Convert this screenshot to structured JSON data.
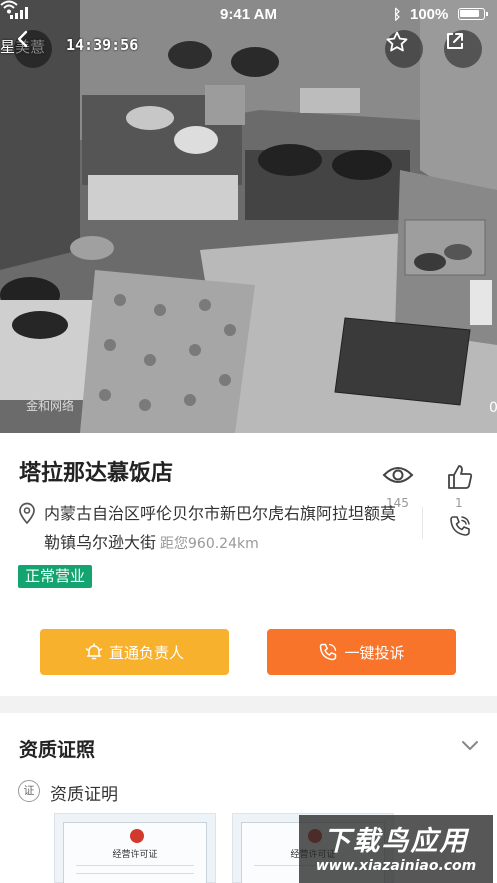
{
  "status_bar": {
    "time": "9:41 AM",
    "battery": "100%"
  },
  "camera": {
    "label": "星美薏",
    "timestamp": "14:39:56",
    "watermark": "金和网络",
    "edge_digit": "0"
  },
  "shop": {
    "name": "塔拉那达慕饭店",
    "address": "内蒙古自治区呼伦贝尔市新巴尔虎右旗阿拉坦额莫勒镇乌尔逊大街",
    "distance": "距您960.24km",
    "status": "正常营业",
    "views": "145",
    "likes": "1"
  },
  "actions": {
    "contact_label": "直通负责人",
    "complain_label": "一键投诉"
  },
  "qualification": {
    "title": "资质证照",
    "sub_icon": "证",
    "sub_label": "资质证明",
    "cert_title": "经营许可证"
  },
  "download_watermark": {
    "big": "下载鸟应用",
    "small": "www.xiazainiao.com"
  },
  "colors": {
    "status_green": "#13a470",
    "contact_yellow": "#f8b12c",
    "complain_orange": "#f7742a"
  },
  "icons": [
    "back-icon",
    "star-icon",
    "share-icon",
    "eye-icon",
    "thumbs-up-icon",
    "phone-icon",
    "location-pin-icon",
    "bell-icon",
    "chevron-down-icon"
  ]
}
